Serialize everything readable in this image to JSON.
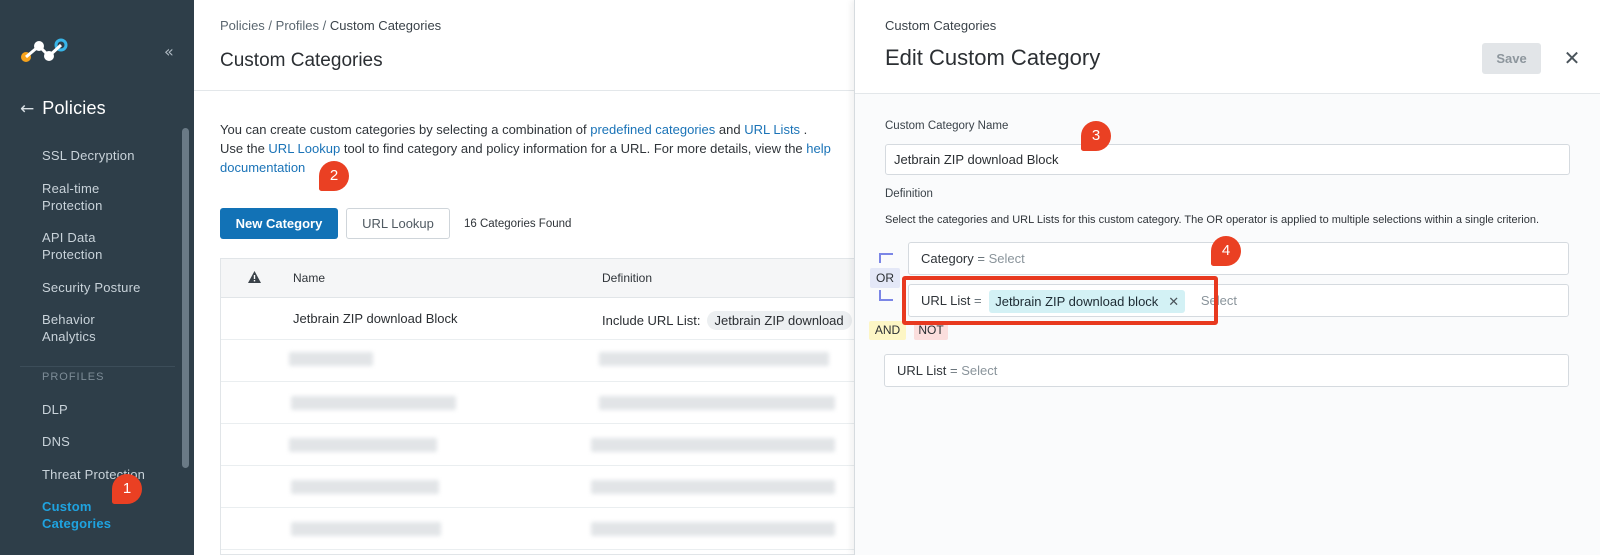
{
  "sidebar": {
    "back_label": "Policies",
    "collapse_icon": "double-chevron-left-icon",
    "items": [
      {
        "label": "SSL Decryption"
      },
      {
        "label": "Real-time Protection"
      },
      {
        "label": "API Data Protection"
      },
      {
        "label": "Security Posture"
      },
      {
        "label": "Behavior Analytics"
      }
    ],
    "section_label": "PROFILES",
    "profile_items": [
      {
        "label": "DLP"
      },
      {
        "label": "DNS"
      },
      {
        "label": "Threat Protection"
      },
      {
        "label": "Custom Categories",
        "active": true
      }
    ]
  },
  "main": {
    "breadcrumb": [
      "Policies",
      "Profiles",
      "Custom Categories"
    ],
    "breadcrumb_sep": "/",
    "title": "Custom Categories",
    "intro": {
      "t1": "You can create custom categories by selecting a combination of ",
      "link1": "predefined categories",
      "t2": " and ",
      "link2": "URL Lists",
      "t3": " . Use the ",
      "link3": "URL Lookup",
      "t4": " tool to find category and policy information for a URL. For more details, view the ",
      "link4": "help documentation"
    },
    "new_category_label": "New Category",
    "url_lookup_label": "URL Lookup",
    "count_text": "16 Categories Found",
    "table": {
      "columns": [
        "Name",
        "Definition"
      ],
      "rows": [
        {
          "name": "Jetbrain ZIP download Block",
          "definition_label": "Include URL List:",
          "definition_chip": "Jetbrain ZIP download"
        }
      ]
    }
  },
  "panel": {
    "subtitle": "Custom Categories",
    "title": "Edit Custom Category",
    "save_label": "Save",
    "name_label": "Custom Category Name",
    "name_value": "Jetbrain ZIP download Block",
    "definition_label": "Definition",
    "definition_help": "Select the categories and URL Lists for this custom category. The OR operator is applied to multiple selections within a single criterion.",
    "criteria": {
      "category_label": "Category",
      "category_placeholder": "Select",
      "url_list_label": "URL List",
      "url_list_chip": "Jetbrain ZIP download block",
      "url_list_placeholder": "Select",
      "eq": "=",
      "or_label": "OR",
      "and_label": "AND",
      "not_label": "NOT",
      "not_url_list_label": "URL List",
      "not_url_list_placeholder": "Select"
    }
  },
  "markers": [
    "1",
    "2",
    "3",
    "4"
  ],
  "colors": {
    "sidebar_bg": "#2e3e49",
    "primary": "#1272b6",
    "link": "#1a73b7",
    "active_nav": "#1fa3e0",
    "marker": "#ea4023"
  }
}
